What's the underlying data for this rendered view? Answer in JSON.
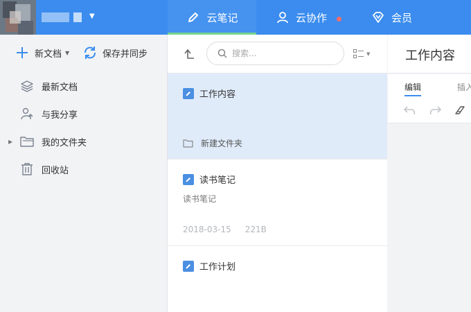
{
  "colors": {
    "topbar": "#3b8cee",
    "active_tab_underline": "#76d38c",
    "notification_dot": "#f56c6c",
    "selected_card": "#e0ebfa",
    "doc_icon": "#4a8fe2"
  },
  "header": {
    "tabs": [
      {
        "label": "云笔记",
        "icon": "pen-icon",
        "active": true
      },
      {
        "label": "云协作",
        "icon": "person-icon",
        "has_badge": true
      },
      {
        "label": "会员",
        "icon": "diamond-icon"
      }
    ]
  },
  "sidebar": {
    "new_doc_label": "新文档",
    "sync_label": "保存并同步",
    "items": [
      {
        "label": "最新文档",
        "icon": "layers-icon"
      },
      {
        "label": "与我分享",
        "icon": "share-user-icon"
      },
      {
        "label": "我的文件夹",
        "icon": "folder-icon",
        "expandable": true
      },
      {
        "label": "回收站",
        "icon": "trash-icon"
      }
    ]
  },
  "notelist": {
    "search_placeholder": "搜索...",
    "notes": [
      {
        "title": "工作内容",
        "folder": "新建文件夹",
        "selected": true
      },
      {
        "title": "读书笔记",
        "snippet": "读书笔记",
        "date": "2018-03-15",
        "size": "221B"
      },
      {
        "title": "工作计划"
      }
    ]
  },
  "editor": {
    "title": "工作内容",
    "tabs": [
      {
        "label": "编辑",
        "active": true
      },
      {
        "label": "插入"
      }
    ]
  }
}
